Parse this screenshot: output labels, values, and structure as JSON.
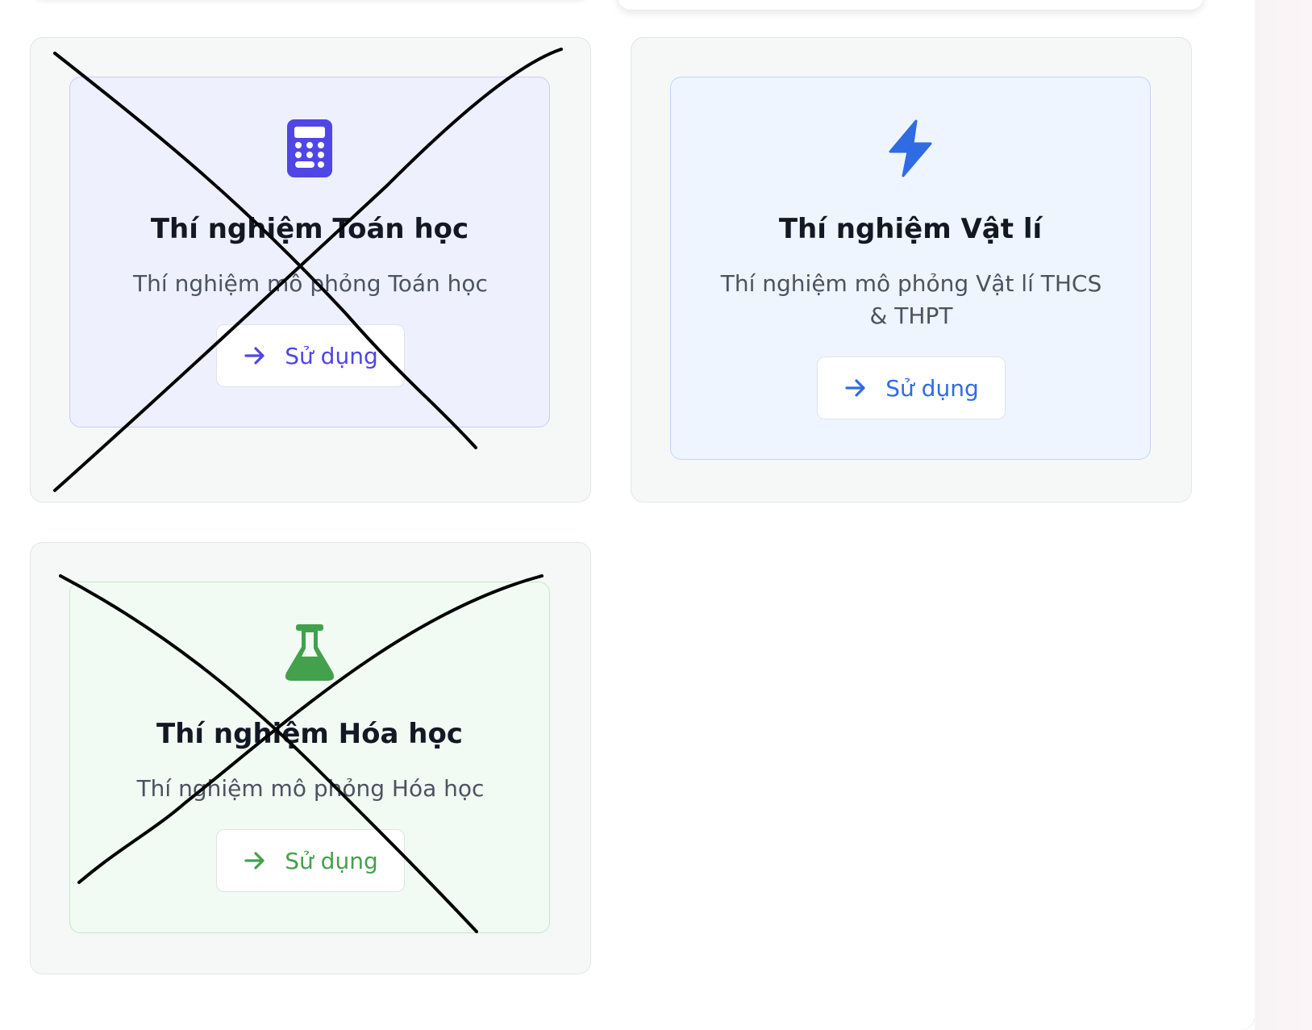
{
  "cards": [
    {
      "title": "Thí nghiệm Toán học",
      "description": "Thí nghiệm mô phỏng Toán học",
      "button_label": "Sử dụng",
      "icon": "calculator-icon",
      "accent": "#4f46e5",
      "inner_bg": "#eef0fe",
      "inner_border": "#c7cdf8",
      "crossed_out": true
    },
    {
      "title": "Thí nghiệm Vật lí",
      "description": "Thí nghiệm mô phỏng Vật lí THCS & THPT",
      "button_label": "Sử dụng",
      "icon": "lightning-bolt-icon",
      "accent": "#2f6be3",
      "inner_bg": "#eef5fe",
      "inner_border": "#bfd6f6",
      "crossed_out": false
    },
    {
      "title": "Thí nghiệm Hóa học",
      "description": "Thí nghiệm mô phỏng Hóa học",
      "button_label": "Sử dụng",
      "icon": "flask-icon",
      "accent": "#43a04c",
      "inner_bg": "#f1fbf3",
      "inner_border": "#bfe9c7",
      "crossed_out": true
    }
  ]
}
